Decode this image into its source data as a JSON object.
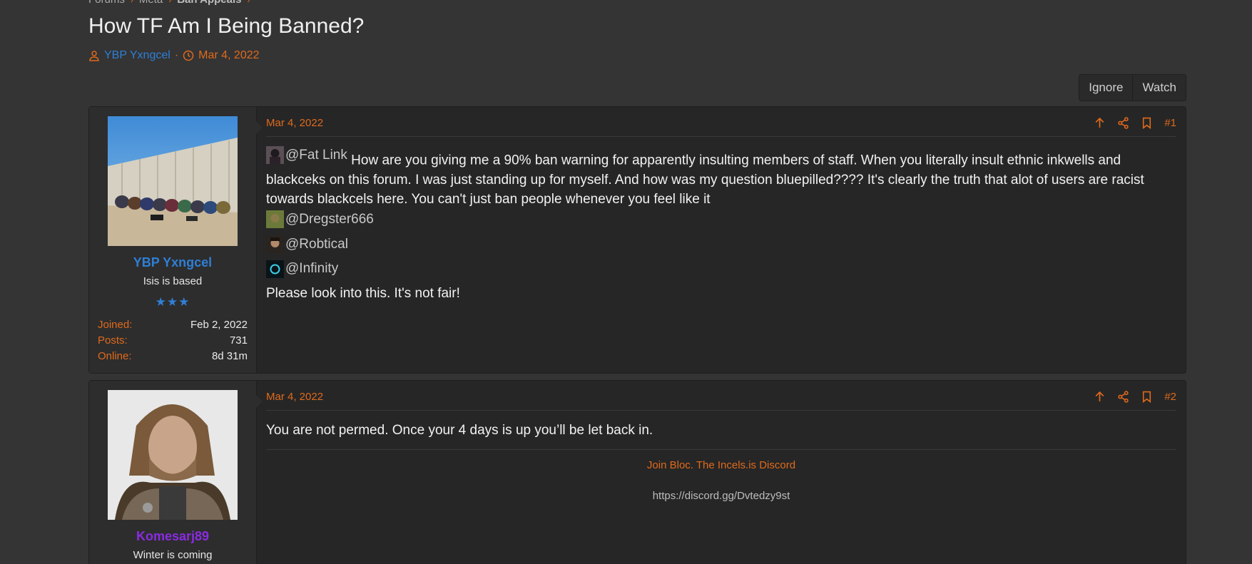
{
  "breadcrumb": {
    "items": [
      "Forums",
      "Meta",
      "Ban Appeals"
    ]
  },
  "thread": {
    "title": "How TF Am I Being Banned?",
    "author": "YBP Yxngcel",
    "separator": "·",
    "date": "Mar 4, 2022"
  },
  "actions": {
    "ignore_label": "Ignore",
    "watch_label": "Watch"
  },
  "colors": {
    "accent": "#e06a1c",
    "author_blue": "#2f7fd6",
    "mod_purple": "#8a2be2",
    "background": "#343434"
  },
  "posts": [
    {
      "username": "YBP Yxngcel",
      "username_color": "#2f7fd6",
      "user_title": "Isis is based",
      "stars": "★★★",
      "stats": {
        "joined_label": "Joined:",
        "joined": "Feb 2, 2022",
        "posts_label": "Posts:",
        "posts": "731",
        "online_label": "Online:",
        "online": "8d 31m"
      },
      "date": "Mar 4, 2022",
      "number": "#1",
      "mention_main": "@Fat Link",
      "text_main": " How are you giving me a 90% ban warning for apparently insulting members of staff. When you literally insult ethnic inkwells and blackceks on this forum. I was just standing up for myself. And how was my question bluepilled???? It's clearly the truth that alot of users are racist towards blackcels here. You can't just ban people whenever you feel like it",
      "mentions": [
        "@Dregster666",
        "@Robtical",
        "@Infinity"
      ],
      "closing": "Please look into this. It's not fair!"
    },
    {
      "username": "Komesarj89",
      "username_color": "#8a2be2",
      "user_title": "Winter is coming",
      "date": "Mar 4, 2022",
      "number": "#2",
      "text": "You are not permed. Once your 4 days is up you’ll be let back in.",
      "signature": {
        "link_text": "Join Bloc. The Incels.is Discord",
        "url_text": "https://discord.gg/Dvtedzy9st"
      }
    }
  ]
}
